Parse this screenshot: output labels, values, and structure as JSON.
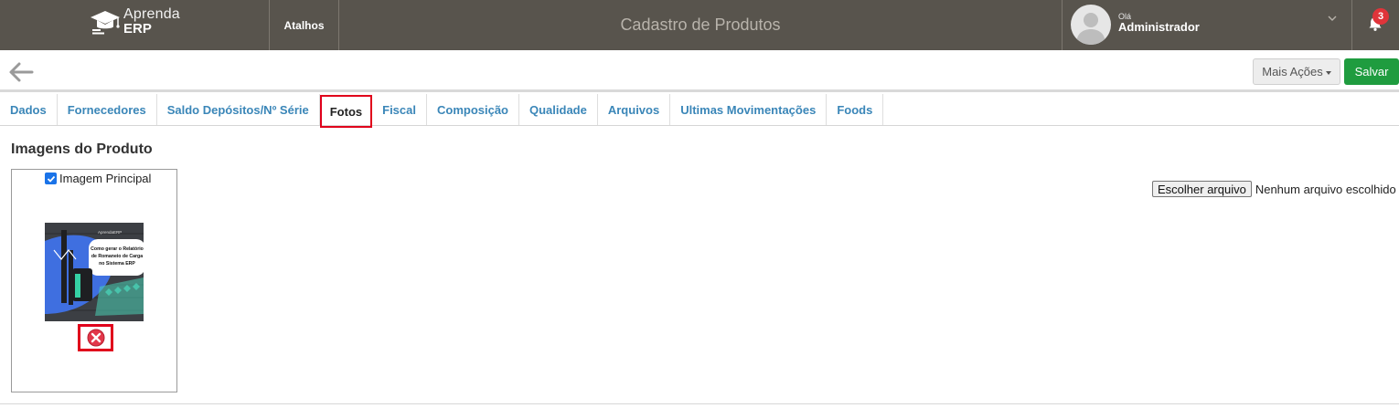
{
  "app": {
    "logo_line1": "Aprenda",
    "logo_line2": "ERP"
  },
  "header": {
    "shortcuts_label": "Atalhos",
    "page_title": "Cadastro de Produtos",
    "greeting": "Olá",
    "user_name": "Administrador",
    "notification_count": "3",
    "colors": {
      "bar": "#58544d",
      "badge": "#e0343a"
    }
  },
  "toolbar": {
    "more_actions_label": "Mais Ações",
    "save_label": "Salvar",
    "save_color": "#1f9c3f"
  },
  "tabs": [
    {
      "label": "Dados"
    },
    {
      "label": "Fornecedores"
    },
    {
      "label": "Saldo Depósitos/Nº Série"
    },
    {
      "label": "Fotos",
      "active": true
    },
    {
      "label": "Fiscal"
    },
    {
      "label": "Composição"
    },
    {
      "label": "Qualidade"
    },
    {
      "label": "Arquivos"
    },
    {
      "label": "Ultimas Movimentações"
    },
    {
      "label": "Foods"
    }
  ],
  "images": {
    "section_title": "Imagens do Produto",
    "main_image_label": "Imagem Principal",
    "main_image_checked": true,
    "thumbnail_text": [
      "Como gerar o Relatório",
      "de Romaneio de Carga",
      "no Sistema ERP"
    ],
    "thumbnail_logo": "AprendaERP"
  },
  "upload": {
    "button_label": "Escolher arquivo",
    "status_text": "Nenhum arquivo escolhido"
  }
}
